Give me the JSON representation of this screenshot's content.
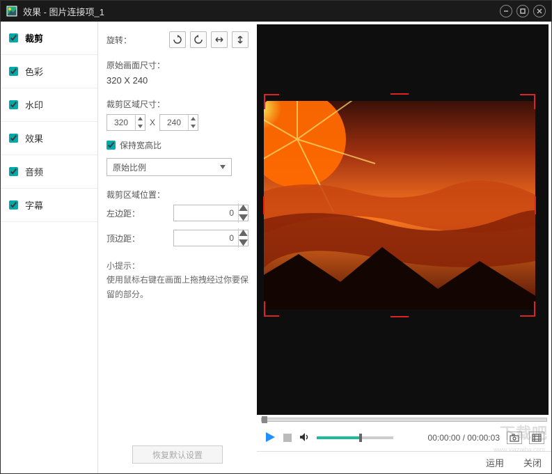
{
  "title": "效果 - 图片连接项_1",
  "sidebar": {
    "items": [
      {
        "label": "裁剪",
        "checked": true,
        "active": true
      },
      {
        "label": "色彩",
        "checked": true,
        "active": false
      },
      {
        "label": "水印",
        "checked": true,
        "active": false
      },
      {
        "label": "效果",
        "checked": true,
        "active": false
      },
      {
        "label": "音频",
        "checked": true,
        "active": false
      },
      {
        "label": "字幕",
        "checked": true,
        "active": false
      }
    ]
  },
  "settings": {
    "rotate_label": "旋转：",
    "orig_size_label": "原始画面尺寸：",
    "orig_size_value": "320 X 240",
    "crop_size_label": "裁剪区域尺寸：",
    "crop_w": "320",
    "crop_x_sep": "X",
    "crop_h": "240",
    "keep_ratio_label": "保持宽高比",
    "keep_ratio_checked": true,
    "ratio_select": "原始比例",
    "crop_pos_label": "裁剪区域位置：",
    "left_label": "左边距：",
    "left_value": "0",
    "top_label": "顶边距：",
    "top_value": "0",
    "tip_title": "小提示：",
    "tip_text": "使用鼠标右键在画面上拖拽经过你要保留的部分。",
    "restore_label": "恢复默认设置"
  },
  "player": {
    "time_current": "00:00:00",
    "time_sep": " / ",
    "time_total": "00:00:03"
  },
  "footer": {
    "apply": "运用",
    "close": "关闭"
  },
  "watermark": {
    "big": "下载吧",
    "small": "www.xiazaiba.com"
  }
}
